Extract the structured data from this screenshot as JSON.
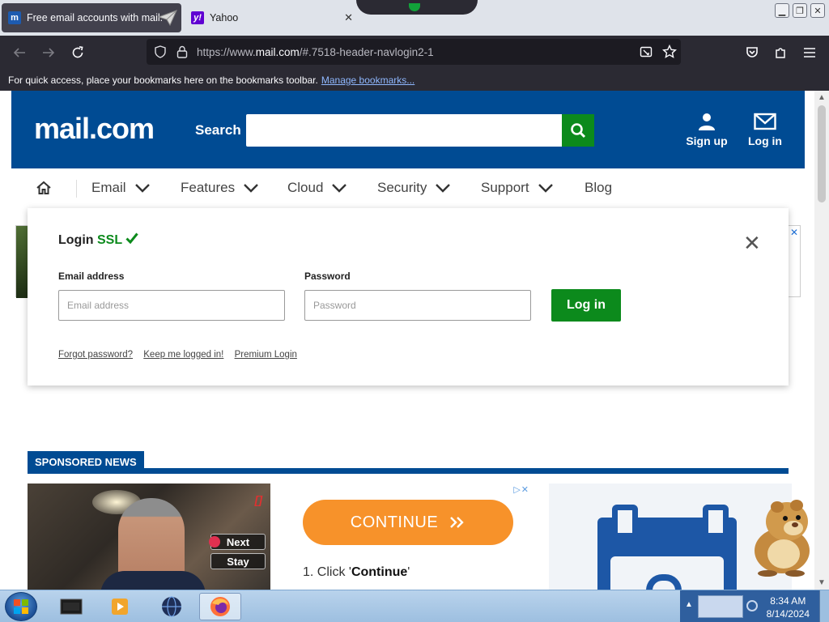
{
  "browser": {
    "tabs": [
      {
        "title": "Free email accounts with mail.",
        "favicon": "m",
        "active": true
      },
      {
        "title": "Yahoo",
        "favicon": "y!",
        "active": false
      }
    ],
    "url_prefix": "https://www.",
    "url_domain": "mail.com",
    "url_rest": "/#.7518-header-navlogin2-1",
    "bookmarks_text": "For quick access, place your bookmarks here on the bookmarks toolbar.",
    "bookmarks_link": "Manage bookmarks..."
  },
  "site": {
    "logo": "mail.com",
    "search_label": "Search",
    "search_value": "",
    "signup_label": "Sign up",
    "login_label": "Log in",
    "nav": [
      "Email",
      "Features",
      "Cloud",
      "Security",
      "Support",
      "Blog"
    ]
  },
  "login": {
    "title": "Login",
    "ssl": "SSL",
    "email_label": "Email address",
    "email_placeholder": "Email address",
    "password_label": "Password",
    "password_placeholder": "Password",
    "button": "Log in",
    "links": [
      "Forgot password?",
      "Keep me logged in!",
      "Premium Login"
    ]
  },
  "sponsored": {
    "heading": "SPONSORED NEWS",
    "video_next": "Next",
    "video_stay": "Stay",
    "video_corner": "[]",
    "ad_continue": "CONTINUE",
    "ad_step_prefix": "1. Click '",
    "ad_step_bold": "Continue",
    "ad_step_suffix": "'"
  },
  "taskbar": {
    "time": "8:34 AM",
    "date": "8/14/2024"
  },
  "colors": {
    "brand_blue": "#004b93",
    "accent_green": "#0c8a1c",
    "ad_orange": "#f7922a"
  },
  "icons": [
    "back-arrow-icon",
    "forward-arrow-icon",
    "reload-icon",
    "shield-icon",
    "lock-icon",
    "reader-view-icon",
    "star-icon",
    "pocket-icon",
    "extensions-icon",
    "menu-icon",
    "search-icon",
    "user-icon",
    "envelope-icon",
    "home-icon",
    "chevron-down-icon",
    "close-icon",
    "checkmark-icon"
  ]
}
